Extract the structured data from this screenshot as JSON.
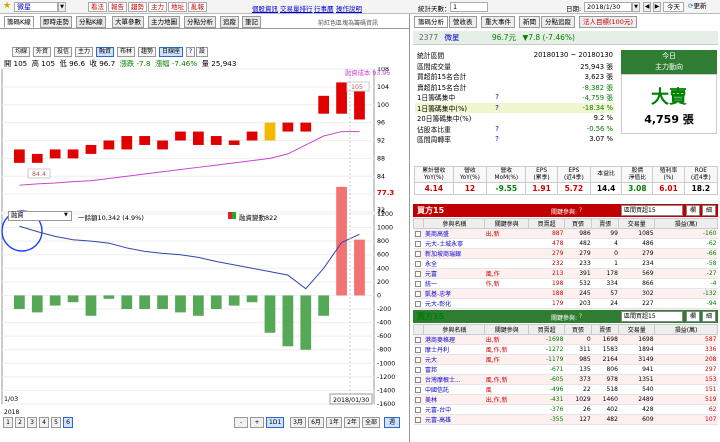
{
  "topbar": {
    "star_icon": "★",
    "stock_name": "微星",
    "buttons": [
      "看法",
      "報告",
      "趨勢",
      "主力",
      "地址",
      "亂報"
    ],
    "links": [
      "個股資訊",
      "交易量排行",
      "行事曆",
      "操作說明"
    ],
    "stat_days_label": "統計天數：",
    "stat_days_value": "1",
    "date_label": "日期:",
    "date_value": "2018/1/30",
    "today_btn": "今天",
    "refresh_btn": "更新"
  },
  "left": {
    "tabs": [
      "籌碼K線",
      "即時走勢",
      "分點K線",
      "大單參數",
      "主力地圖",
      "分點分析",
      "追蹤",
      "筆記"
    ],
    "right_note": "前紅色區塊為籌碼資訊",
    "subbtns": [
      "均線",
      "外資",
      "投信",
      "主力",
      "融資",
      "布林",
      "趨勢",
      "日線座",
      "?",
      "設"
    ],
    "active_subbtns": [
      "融資",
      "日線座"
    ],
    "ohlc": {
      "open_label": "開",
      "open": "105",
      "high_label": "高",
      "high": "105",
      "low_label": "低",
      "low": "96.6",
      "close_label": "收",
      "close": "96.7",
      "change_label": "漲跌",
      "change": "-7.8",
      "pct_label": "漲幅",
      "pct": "-7.46%",
      "vol_label": "量",
      "vol": "25,943"
    },
    "cost_label": "融資成本 93.96",
    "price_axis": [
      "108",
      "104",
      "100",
      "96",
      "92",
      "88",
      "84",
      "80",
      "76"
    ],
    "last_price": "77.3",
    "price_tag_top": "105",
    "price_tag_low": "84.4",
    "indicator_select": "融資",
    "indicator_info": "一餘額10,342 (4.9%)",
    "indicator_legend": "融資變動822",
    "vol_axis": [
      "1200",
      "1000",
      "800",
      "600",
      "400",
      "200",
      "0",
      "-200",
      "-400",
      "-600",
      "-800",
      "-1000",
      "-1200",
      "-1400",
      "-1600"
    ],
    "vol_axis_top": "72",
    "date_start": "1/03",
    "year_start": "2018",
    "date_end": "2018/01/30",
    "pages": [
      "1",
      "2",
      "3",
      "4",
      "5",
      "6"
    ],
    "range_btns": [
      "3月",
      "6月",
      "1年",
      "2年",
      "全部",
      "週"
    ],
    "nav_btns": [
      "-",
      "+",
      "1D1"
    ]
  },
  "right": {
    "tabs": [
      "籌碼分析",
      "營收表",
      "重大事件",
      "新聞",
      "分點追蹤",
      "法人目標(100元)"
    ],
    "stock_code": "2377",
    "stock_name": "微星",
    "price": "96.7元",
    "change": "▼7.8 (-7.46%)",
    "stats": [
      {
        "label": "統計區間",
        "value": "20180130 ~ 20180130"
      },
      {
        "label": "區間成交量",
        "value": "25,943 張"
      },
      {
        "label": "買超前15名合計",
        "value": "3,623 張"
      },
      {
        "label": "賣超前15名合計",
        "value": "-8,382 張"
      },
      {
        "label": "1日籌碼集中",
        "q": "?",
        "value": "-4,759 張"
      },
      {
        "label": "1日籌碼集中(%)",
        "q": "?",
        "value": "-18.34 %"
      },
      {
        "label": "20日籌碼集中(%)",
        "value": "9.2 %"
      },
      {
        "label": "佔股本比重",
        "q": "?",
        "value": "-0.56 %"
      },
      {
        "label": "區間周轉率",
        "q": "?",
        "value": "3.07 %"
      }
    ],
    "today_title": "今日",
    "today_sub": "主力動向",
    "big_signal": "大賣",
    "big_qty": "4,759 張",
    "kpi_headers": [
      "累計營收\nYoY(%)",
      "營收\nYoY(%)",
      "營收\nMoM(%)",
      "EPS\n(累季)",
      "EPS\n(近4季)",
      "本益比",
      "股價\n淨值比",
      "殖利率\n(%)",
      "ROE\n(近4季)"
    ],
    "kpi_values": [
      "4.14",
      "12",
      "-9.55",
      "1.91",
      "5.72",
      "14.4",
      "3.08",
      "6.01",
      "18.2"
    ],
    "buy_title": "買方15",
    "sell_title": "賣方15",
    "filter_label": "關鍵參與:",
    "filter_select": "區間買超15",
    "filter_btn1": "欄",
    "filter_btn2": "細",
    "q": "?",
    "cols": [
      "參與名稱",
      "關鍵參與",
      "買賣超",
      "買張",
      "賣張",
      "交易量",
      "損益(萬)"
    ],
    "buy_rows": [
      [
        "美商高盛",
        "出,新",
        "887",
        "986",
        "99",
        "1085",
        "-160"
      ],
      [
        "元大-土城永寧",
        "",
        "478",
        "482",
        "4",
        "486",
        "-62"
      ],
      [
        "新加坡商瑞銀",
        "",
        "279",
        "279",
        "0",
        "279",
        "-66"
      ],
      [
        "永全",
        "",
        "232",
        "233",
        "1",
        "234",
        "-58"
      ],
      [
        "元富",
        "風,作",
        "213",
        "391",
        "178",
        "569",
        "-27"
      ],
      [
        "統一",
        "作,新",
        "198",
        "532",
        "334",
        "866",
        "-4"
      ],
      [
        "凱基-忠孝",
        "",
        "188",
        "245",
        "57",
        "302",
        "-132"
      ],
      [
        "元大-彰化",
        "",
        "179",
        "203",
        "24",
        "227",
        "-94"
      ],
      [
        "宏遠",
        "",
        "179",
        "449",
        "270",
        "719",
        "-78"
      ]
    ],
    "sell_rows": [
      [
        "港商麥格理",
        "出,新",
        "-1698",
        "0",
        "1698",
        "1698",
        "587"
      ],
      [
        "摩士丹利",
        "風,作,新",
        "-1272",
        "311",
        "1583",
        "1894",
        "336"
      ],
      [
        "元大",
        "風,作",
        "-1179",
        "985",
        "2164",
        "3149",
        "208"
      ],
      [
        "富邦",
        "",
        "-671",
        "135",
        "806",
        "941",
        "297"
      ],
      [
        "台灣摩根士...",
        "風,作,新",
        "-605",
        "373",
        "978",
        "1351",
        "153"
      ],
      [
        "中國信託",
        "風",
        "-496",
        "22",
        "518",
        "540",
        "151"
      ],
      [
        "美林",
        "出,作,新",
        "-431",
        "1029",
        "1460",
        "2489",
        "519"
      ],
      [
        "元富-台中",
        "",
        "-376",
        "26",
        "402",
        "428",
        "62"
      ],
      [
        "元富-高雄",
        "",
        "-355",
        "127",
        "482",
        "609",
        "107"
      ]
    ]
  },
  "chart_data": {
    "type": "bar",
    "title": "",
    "candles": [
      {
        "o": 87,
        "c": 90
      },
      {
        "o": 89,
        "c": 87
      },
      {
        "o": 88,
        "c": 90
      },
      {
        "o": 90,
        "c": 88
      },
      {
        "o": 91,
        "c": 89
      },
      {
        "o": 92,
        "c": 90
      },
      {
        "o": 93,
        "c": 90
      },
      {
        "o": 93,
        "c": 91
      },
      {
        "o": 92,
        "c": 90
      },
      {
        "o": 92,
        "c": 94
      },
      {
        "o": 94,
        "c": 91
      },
      {
        "o": 93,
        "c": 91
      },
      {
        "o": 92,
        "c": 91
      },
      {
        "o": 94,
        "c": 92
      },
      {
        "o": 96,
        "c": 92
      },
      {
        "o": 96,
        "c": 94
      },
      {
        "o": 96,
        "c": 94
      },
      {
        "o": 102,
        "c": 98
      },
      {
        "o": 105,
        "c": 98
      },
      {
        "o": 105,
        "c": 96.7
      }
    ],
    "cost_line": [
      82,
      82.3,
      82.5,
      82.8,
      83,
      83.5,
      84,
      84.5,
      85,
      85.5,
      86,
      86.5,
      87,
      87.5,
      88,
      89,
      91,
      93,
      94,
      94
    ],
    "price_ylim": [
      76,
      108
    ],
    "margin_change": [
      -200,
      -250,
      -150,
      -100,
      -300,
      -50,
      -200,
      -200,
      -200,
      -250,
      -300,
      -200,
      -150,
      -100,
      -550,
      -750,
      -800,
      -300,
      1600,
      822
    ],
    "balance_line": [
      1020,
      940,
      870,
      820,
      800,
      770,
      700,
      650,
      620,
      600,
      560,
      500,
      450,
      400,
      350,
      300,
      100,
      400,
      780,
      900
    ],
    "vol_ylim": [
      -1600,
      1200
    ]
  }
}
